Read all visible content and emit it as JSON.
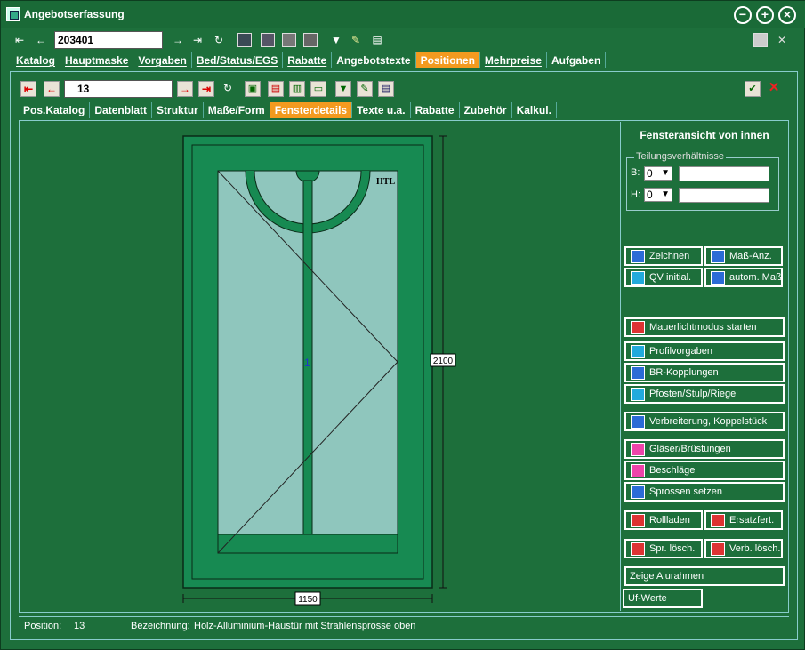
{
  "window": {
    "title": "Angebotserfassung",
    "controls": [
      "−",
      "+",
      "×"
    ]
  },
  "toolbar1": {
    "record_value": "203401"
  },
  "main_tabs": [
    {
      "label": "Katalog"
    },
    {
      "label": "Hauptmaske"
    },
    {
      "label": "Vorgaben"
    },
    {
      "label": "Bed/Status/EGS"
    },
    {
      "label": "Rabatte"
    },
    {
      "label": "Angebotstexte"
    },
    {
      "label": "Positionen",
      "active": true
    },
    {
      "label": "Mehrpreise"
    },
    {
      "label": "Aufgaben"
    }
  ],
  "toolbar2": {
    "position_value": "13"
  },
  "sub_tabs": [
    {
      "label": "Pos.Katalog"
    },
    {
      "label": "Datenblatt"
    },
    {
      "label": "Struktur"
    },
    {
      "label": "Maße/Form"
    },
    {
      "label": "Fensterdetails",
      "active": true
    },
    {
      "label": "Texte u.a."
    },
    {
      "label": "Rabatte"
    },
    {
      "label": "Zubehör"
    },
    {
      "label": "Kalkul."
    }
  ],
  "drawing": {
    "width_label": "1150",
    "height_label": "2100",
    "corner_label": "HTL",
    "sash_label": "1"
  },
  "right_panel": {
    "title": "Fensteransicht von innen",
    "group_label": "Teilungsverhältnisse",
    "b_label": "B:",
    "b_value": "0",
    "h_label": "H:",
    "h_value": "0",
    "buttons": {
      "zeichnen": "Zeichnen",
      "mass_anz": "Maß-Anz.",
      "qv_initial": "QV initial.",
      "autom_mass": "autom. Maß",
      "mauerlicht": "Mauerlichtmodus starten",
      "profilvorgaben": "Profilvorgaben",
      "br_kopplungen": "BR-Kopplungen",
      "pfosten": "Pfosten/Stulp/Riegel",
      "verbreiterung": "Verbreiterung, Koppelstück",
      "glaeser": "Gläser/Brüstungen",
      "beschlaege": "Beschläge",
      "sprossen": "Sprossen setzen",
      "rollladen": "Rollladen",
      "ersatzfert": "Ersatzfert.",
      "spr_loesch": "Spr. lösch.",
      "verb_loesch": "Verb. lösch.",
      "alurahmen": "Zeige Alurahmen",
      "uf_werte": "Uf-Werte"
    }
  },
  "status": {
    "position_label": "Position:",
    "position_value": "13",
    "bezeichnung_label": "Bezeichnung:",
    "bezeichnung_value": "Holz-Alluminium-Haustür mit Strahlensprosse oben"
  },
  "colors": {
    "background": "#1d6f3b",
    "active_tab": "#f39a1f",
    "glass": "#8fc6bd",
    "frame": "#178a52"
  }
}
